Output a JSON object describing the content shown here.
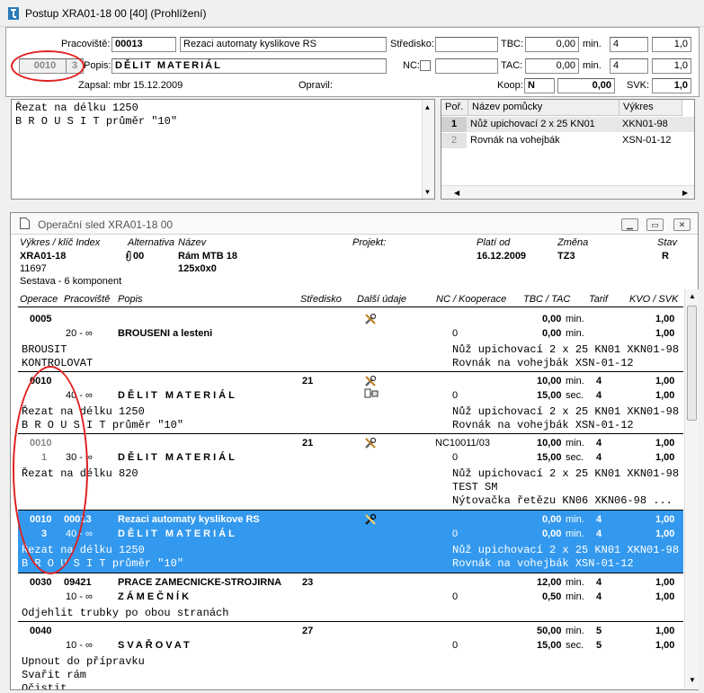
{
  "window": {
    "title": "Postup XRA01-18 00 [40] (Prohlížení)"
  },
  "header": {
    "pracoviste_label": "Pracoviště:",
    "pracoviste_code": "00013",
    "pracoviste_name": "Rezaci automaty kyslikove RS",
    "stredisko_label": "Středisko:",
    "stredisko_value": "",
    "tbc_label": "TBC:",
    "tbc_value": "0,00",
    "tbc_unit": "min.",
    "tbc_tarif": "4",
    "tbc_koef": "1,0",
    "op_number": "0010",
    "op_sub": "3",
    "popis_label": "Popis:",
    "popis_value": "DĚLIT MATERIÁL",
    "nc_label": "NC:",
    "nc_value": "",
    "tac_label": "TAC:",
    "tac_value": "0,00",
    "tac_unit": "min.",
    "tac_tarif": "4",
    "tac_koef": "1,0",
    "zapsal": "Zapsal: mbr  15.12.2009",
    "opravil_label": "Opravil:",
    "koop_label": "Koop:",
    "koop_value": "N",
    "koop_amount": "0,00",
    "svk_label": "SVK:",
    "svk_value": "1,0"
  },
  "notes": [
    "Řezat na délku 1250",
    "B R O U S I T průměr \"10\""
  ],
  "tools": {
    "columns": [
      "Poř.",
      "Název pomůcky",
      "Výkres"
    ],
    "rows": [
      {
        "por": "1",
        "nazev": "Nůž upichovací 2 x 25 KN01",
        "vykres": "XKN01-98"
      },
      {
        "por": "2",
        "nazev": "Rovnák na vohejbák",
        "vykres": "XSN-01-12"
      }
    ]
  },
  "sled": {
    "title": "Operační sled XRA01-18 00",
    "hdr": {
      "vykres_label": "Výkres / klíč  Index",
      "alternativa_label": "Alternativa",
      "nazev_label": "Název",
      "projekt_label": "Projekt:",
      "plati_label": "Platí od",
      "zmena_label": "Změna",
      "stav_label": "Stav",
      "vykres": "XRA01-18",
      "alternativa": "00",
      "nazev": "Rám MTB 18",
      "nazev2": "125x0x0",
      "plati": "16.12.2009",
      "zmena": "TZ3",
      "stav": "R",
      "klic": "11697",
      "sestava": "Sestava - 6 komponent"
    },
    "columns": {
      "operace": "Operace",
      "pracoviste": "Pracoviště",
      "popis": "Popis",
      "stredisko": "Středisko",
      "dalsi": "Další údaje",
      "nc": "NC / Kooperace",
      "tbctac": "TBC / TAC",
      "tarif": "Tarif",
      "kvo": "KVO / SVK"
    },
    "ops": [
      {
        "op": "0005",
        "pracoviste": "",
        "popis1": "",
        "stredisko": "",
        "sub": "",
        "prac2": "20 - ∞",
        "popis2": "BROUSENI a lesteni",
        "nc": "",
        "koop": "0",
        "tbc": "0,00",
        "tbc_unit": "min.",
        "tbc_tarif": "",
        "tac": "0,00",
        "tac_unit": "min.",
        "tac_tarif": "",
        "kvo": "1,00",
        "svk": "1,00",
        "notes_left": [
          "BROUSIT",
          "KONTROLOVAT"
        ],
        "notes_right": [
          "Nůž upichovací 2 x 25 KN01 XKN01-98",
          "Rovnák na vohejbák XSN-01-12"
        ]
      },
      {
        "op": "0010",
        "pracoviste": "",
        "popis1": "",
        "stredisko": "21",
        "sub": "",
        "prac2": "40 - ∞",
        "popis2": "DĚLIT MATERIÁL",
        "nc": "",
        "koop": "0",
        "tbc": "10,00",
        "tbc_unit": "min.",
        "tbc_tarif": "4",
        "tac": "15,00",
        "tac_unit": "sec.",
        "tac_tarif": "4",
        "kvo": "1,00",
        "svk": "1,00",
        "notes_left": [
          "Řezat na délku 1250",
          "B R O U S I T průměr \"10\""
        ],
        "notes_right": [
          "Nůž upichovací 2 x 25 KN01 XKN01-98",
          "Rovnák na vohejbák XSN-01-12"
        ]
      },
      {
        "op": "0010",
        "pracoviste": "",
        "popis1": "",
        "stredisko": "21",
        "sub": "1",
        "prac2": "30 - ∞",
        "popis2": "DĚLIT MATERIÁL",
        "nc": "NC10011/03",
        "koop": "0",
        "tbc": "10,00",
        "tbc_unit": "min.",
        "tbc_tarif": "4",
        "tac": "15,00",
        "tac_unit": "sec.",
        "tac_tarif": "4",
        "kvo": "1,00",
        "svk": "1,00",
        "notes_left": [
          "Řezat na délku 820"
        ],
        "notes_right": [
          "Nůž upichovací 2 x 25 KN01 XKN01-98",
          "TEST SM",
          "Nýtovačka řetězu KN06 XKN06-98 ..."
        ]
      },
      {
        "op": "0010",
        "pracoviste": "00013",
        "popis1": "Rezaci automaty kyslikove RS",
        "stredisko": "",
        "sub": "3",
        "prac2": "40 - ∞",
        "popis2": "DĚLIT MATERIÁL",
        "nc": "",
        "koop": "0",
        "tbc": "0,00",
        "tbc_unit": "min.",
        "tbc_tarif": "4",
        "tac": "0,00",
        "tac_unit": "min.",
        "tac_tarif": "4",
        "kvo": "1,00",
        "svk": "1,00",
        "notes_left": [
          "Řezat na délku 1250",
          "B R O U S I T průměr \"10\""
        ],
        "notes_right": [
          "Nůž upichovací 2 x 25 KN01 XKN01-98",
          "Rovnák na vohejbák XSN-01-12"
        ]
      },
      {
        "op": "0030",
        "pracoviste": "09421",
        "popis1": "PRACE ZAMECNICKE-STROJIRNA",
        "stredisko": "23",
        "sub": "",
        "prac2": "10 - ∞",
        "popis2": "ZÁMEČNÍK",
        "nc": "",
        "koop": "0",
        "tbc": "12,00",
        "tbc_unit": "min.",
        "tbc_tarif": "4",
        "tac": "0,50",
        "tac_unit": "min.",
        "tac_tarif": "4",
        "kvo": "1,00",
        "svk": "1,00",
        "notes_left": [
          "Odjehlit trubky po obou stranách"
        ],
        "notes_right": []
      },
      {
        "op": "0040",
        "pracoviste": "",
        "popis1": "",
        "stredisko": "27",
        "sub": "",
        "prac2": "10 - ∞",
        "popis2": "SVAŘOVAT",
        "nc": "",
        "koop": "0",
        "tbc": "50,00",
        "tbc_unit": "min.",
        "tbc_tarif": "5",
        "tac": "15,00",
        "tac_unit": "sec.",
        "tac_tarif": "5",
        "kvo": "1,00",
        "svk": "1,00",
        "notes_left": [
          "Upnout do přípravku",
          "Svařit rám",
          "Očistit"
        ],
        "notes_right": []
      }
    ]
  }
}
